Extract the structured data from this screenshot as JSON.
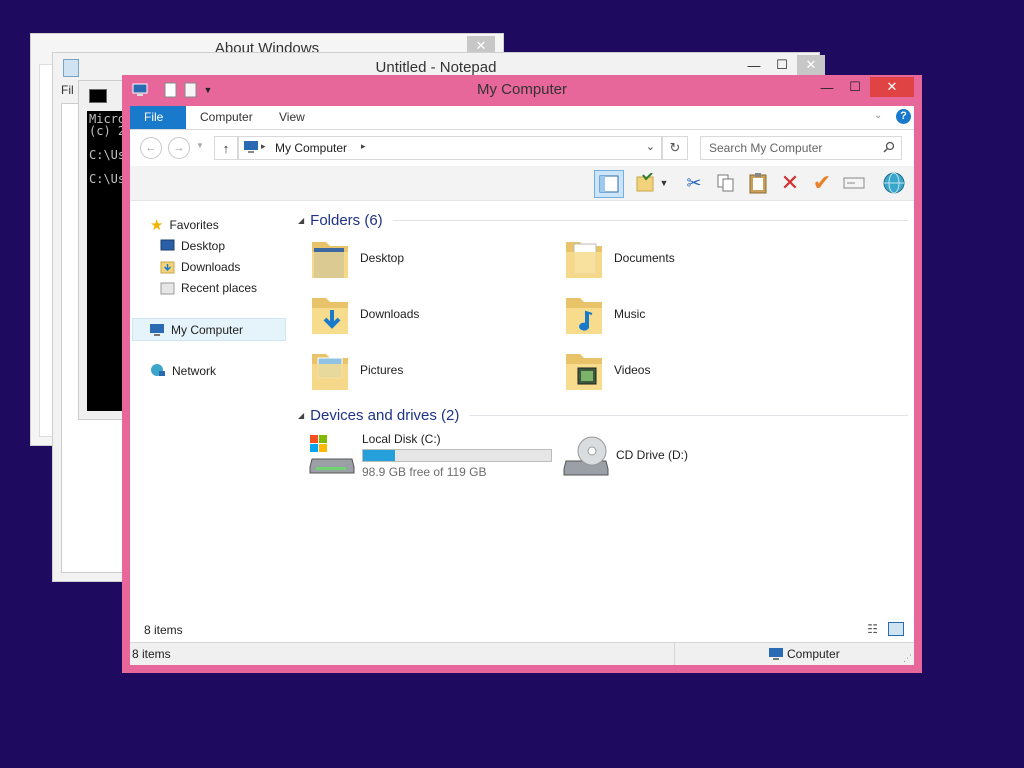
{
  "about_window": {
    "title": "About Windows",
    "close": "✕"
  },
  "notepad": {
    "title": "Untitled - Notepad",
    "menu_first": "Fil",
    "min": "—",
    "max": "☐",
    "close": "✕"
  },
  "cmd": {
    "line1": "Micro",
    "line2": "(c) 2",
    "line3": "C:\\Us",
    "line4": "C:\\Us"
  },
  "explorer": {
    "title": "My Computer",
    "min": "—",
    "max": "☐",
    "close": "✕",
    "tabs": [
      {
        "label": "File"
      },
      {
        "label": "Computer"
      },
      {
        "label": "View"
      }
    ],
    "help": "?",
    "address": {
      "location": "My Computer"
    },
    "search": {
      "placeholder": "Search My Computer"
    },
    "nav": {
      "favorites": "Favorites",
      "desktop": "Desktop",
      "downloads": "Downloads",
      "recent": "Recent places",
      "computer": "My Computer",
      "network": "Network"
    },
    "groups": {
      "folders": "Folders (6)",
      "devices": "Devices and drives (2)"
    },
    "folders": [
      {
        "label": "Desktop"
      },
      {
        "label": "Documents"
      },
      {
        "label": "Downloads"
      },
      {
        "label": "Music"
      },
      {
        "label": "Pictures"
      },
      {
        "label": "Videos"
      }
    ],
    "drives": {
      "c_label": "Local Disk (C:)",
      "c_free": "98.9 GB free of 119 GB",
      "c_used_fraction": 0.17,
      "d_label": "CD Drive (D:)"
    },
    "item_count": "8 items",
    "status": {
      "left": "8 items",
      "right": "Computer"
    }
  },
  "colors": {
    "desktop": "#1e0a5e",
    "accent": "#e8679a",
    "file_tab": "#1979ca",
    "group_text": "#1e3287",
    "folder": "#f2d27a"
  }
}
